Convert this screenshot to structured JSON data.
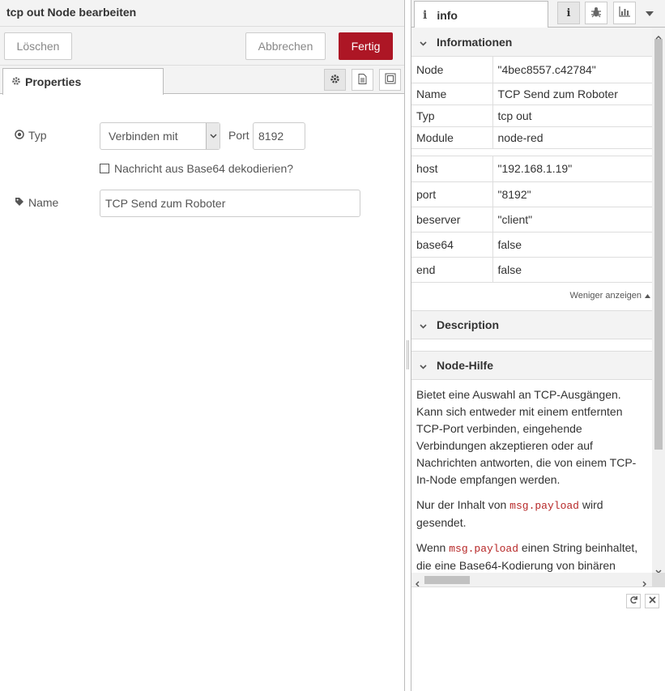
{
  "editor": {
    "title": "tcp out Node bearbeiten",
    "buttons": {
      "delete": "Löschen",
      "cancel": "Abbrechen",
      "done": "Fertig"
    },
    "tab": "Properties",
    "form": {
      "type_label": "Typ",
      "type_value": "Verbinden mit",
      "port_label": "Port",
      "port_value": "8192",
      "base64_label": "Nachricht aus Base64 dekodierien?",
      "name_label": "Name",
      "name_value": "TCP Send zum Roboter"
    }
  },
  "sidebar": {
    "tab": "info",
    "info_section": "Informationen",
    "info_rows": [
      {
        "key": "Node",
        "value": "\"4bec8557.c42784\""
      },
      {
        "key": "Name",
        "value": "TCP Send zum Roboter"
      },
      {
        "key": "Typ",
        "value": "tcp out"
      },
      {
        "key": "Module",
        "value": "node-red"
      }
    ],
    "prop_rows": [
      {
        "key": "host",
        "value": "\"192.168.1.19\""
      },
      {
        "key": "port",
        "value": "\"8192\""
      },
      {
        "key": "beserver",
        "value": "\"client\""
      },
      {
        "key": "base64",
        "value": "false"
      },
      {
        "key": "end",
        "value": "false"
      }
    ],
    "show_less": "Weniger anzeigen",
    "description_section": "Description",
    "help_section": "Node-Hilfe",
    "help": {
      "p1": "Bietet eine Auswahl an TCP-Ausgängen. Kann sich entweder mit einem entfernten TCP-Port verbinden, eingehende Verbindungen akzeptieren oder auf Nachrichten antworten, die von einem TCP-In-Node empfangen werden.",
      "p2_before": "Nur der Inhalt von ",
      "p2_code": "msg.payload",
      "p2_after": " wird gesendet.",
      "p3_before": "Wenn ",
      "p3_code": "msg.payload",
      "p3_after": " einen String beinhaltet, die eine Base64-Kodierung von binären"
    }
  },
  "colors": {
    "primary": "#ad1625",
    "string": "#b72828",
    "boolean": "#1f3fa0"
  }
}
